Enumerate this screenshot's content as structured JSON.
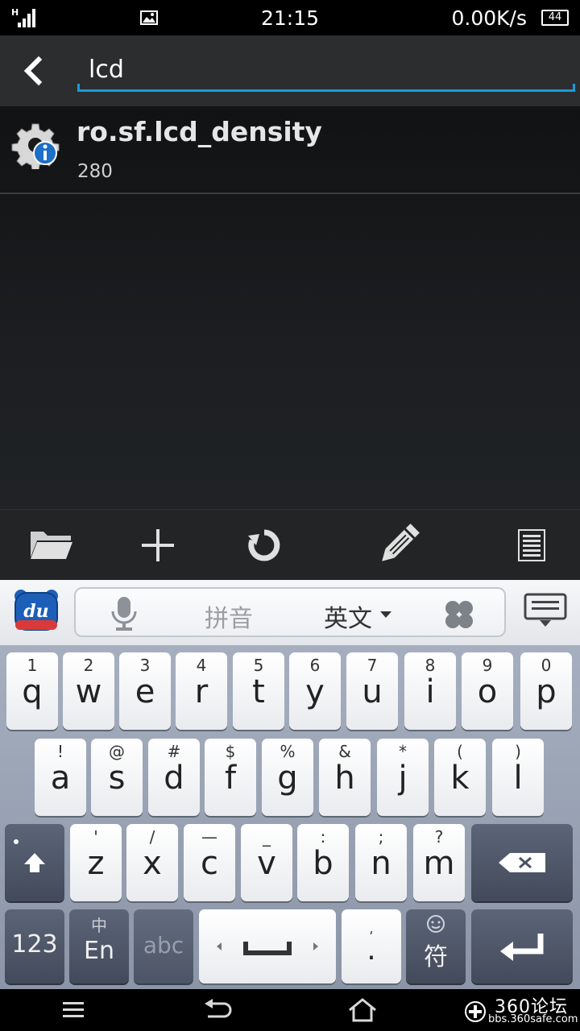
{
  "status_bar": {
    "network_type": "H",
    "time": "21:15",
    "net_speed": "0.00K/s",
    "battery": "44"
  },
  "action_bar": {
    "search_value": "lcd"
  },
  "results": [
    {
      "title": "ro.sf.lcd_density",
      "value": "280",
      "icon": "gear-info-icon"
    }
  ],
  "toolbar": {
    "icons": [
      "folder-icon",
      "add-icon",
      "refresh-icon",
      "edit-icon",
      "list-icon"
    ]
  },
  "keyboard": {
    "top_bar": {
      "logo": "du",
      "pinyin": "拼音",
      "english": "英文"
    },
    "rows": [
      [
        {
          "sub": "1",
          "main": "q"
        },
        {
          "sub": "2",
          "main": "w"
        },
        {
          "sub": "3",
          "main": "e"
        },
        {
          "sub": "4",
          "main": "r"
        },
        {
          "sub": "5",
          "main": "t"
        },
        {
          "sub": "6",
          "main": "y"
        },
        {
          "sub": "7",
          "main": "u"
        },
        {
          "sub": "8",
          "main": "i"
        },
        {
          "sub": "9",
          "main": "o"
        },
        {
          "sub": "0",
          "main": "p"
        }
      ],
      [
        {
          "sub": "!",
          "main": "a"
        },
        {
          "sub": "@",
          "main": "s"
        },
        {
          "sub": "#",
          "main": "d"
        },
        {
          "sub": "$",
          "main": "f"
        },
        {
          "sub": "%",
          "main": "g"
        },
        {
          "sub": "&",
          "main": "h"
        },
        {
          "sub": "*",
          "main": "j"
        },
        {
          "sub": "(",
          "main": "k"
        },
        {
          "sub": ")",
          "main": "l"
        }
      ],
      [
        {
          "sub": "'",
          "main": "z"
        },
        {
          "sub": "/",
          "main": "x"
        },
        {
          "sub": "—",
          "main": "c"
        },
        {
          "sub": "_",
          "main": "v"
        },
        {
          "sub": ":",
          "main": "b"
        },
        {
          "sub": ";",
          "main": "n"
        },
        {
          "sub": "?",
          "main": "m"
        }
      ]
    ],
    "bottom": {
      "numbers": "123",
      "lang_sub": "中",
      "lang_main": "En",
      "abc": "abc",
      "punct_sub": ",",
      "punct_main": ".",
      "symbol_main": "符"
    }
  },
  "watermark": {
    "top": "360论坛",
    "bottom": "bbs.360safe.com"
  }
}
